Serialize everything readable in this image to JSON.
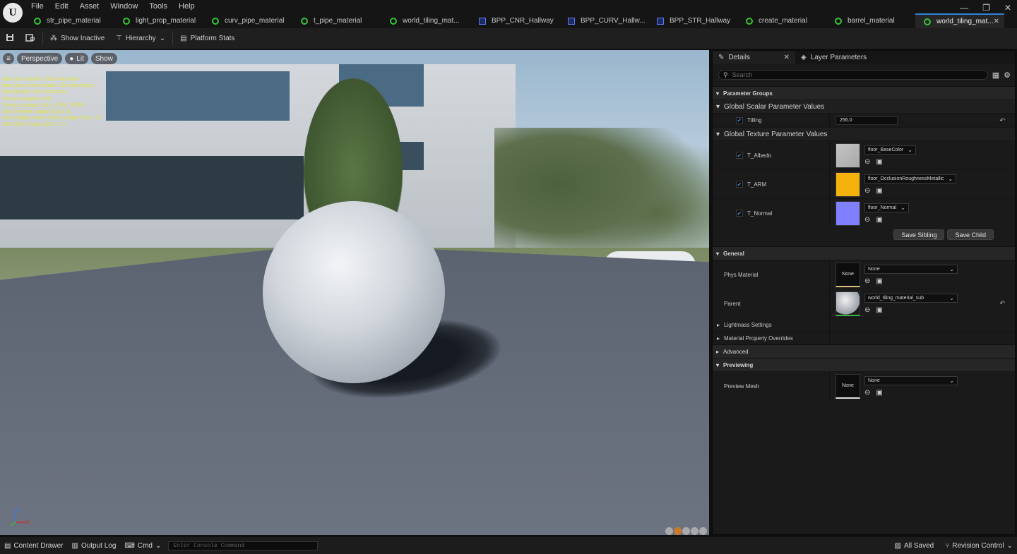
{
  "app": {
    "logo_text": "U"
  },
  "menu": [
    "File",
    "Edit",
    "Asset",
    "Window",
    "Tools",
    "Help"
  ],
  "window_controls": {
    "minimize": "—",
    "restore": "❐",
    "close": "✕"
  },
  "tabs": [
    {
      "label": "str_pipe_material",
      "icon": "material-icon"
    },
    {
      "label": "light_prop_material",
      "icon": "material-icon"
    },
    {
      "label": "curv_pipe_material",
      "icon": "material-icon"
    },
    {
      "label": "t_pipe_material",
      "icon": "material-icon"
    },
    {
      "label": "world_tiling_mat...",
      "icon": "material-icon"
    },
    {
      "label": "BPP_CNR_Hallway",
      "icon": "blueprint-icon"
    },
    {
      "label": "BPP_CURV_Hallw...",
      "icon": "blueprint-icon"
    },
    {
      "label": "BPP_STR_Hallway",
      "icon": "blueprint-icon"
    },
    {
      "label": "create_material",
      "icon": "material-icon"
    },
    {
      "label": "barrel_material",
      "icon": "material-icon"
    },
    {
      "label": "world_tiling_mat...",
      "icon": "material-icon",
      "active": true
    }
  ],
  "toolbar": {
    "show_inactive": "Show Inactive",
    "hierarchy": "Hierarchy",
    "platform_stats": "Platform Stats"
  },
  "viewport": {
    "perspective": "Perspective",
    "lit": "Lit",
    "show": "Show",
    "stats": [
      "Base pass shader: 295 instructions",
      "Base pass vertex shader: 131 instructions",
      "MaxSampler: 362 instructions",
      "Texture samplers: 5/16",
      "Texture Lookups (Est.): VS(0), PS(15)",
      "LWC Promote usages (Est.): 11",
      "LWC Multiply Vector Vector usages (Est.): 11",
      "LWC Other usages (Est.): 15"
    ],
    "axis_z": "Z",
    "axis_x": "X"
  },
  "details": {
    "tab_details": "Details",
    "tab_layer_params": "Layer Parameters",
    "search_placeholder": "Search",
    "parameter_groups": "Parameter Groups",
    "global_scalar": "Global Scalar Parameter Values",
    "tilling_label": "Tilling",
    "tilling_value": "256.0",
    "global_texture": "Global Texture Parameter Values",
    "textures": [
      {
        "label": "T_Albedo",
        "value": "floor_BaseColor",
        "color": "#b9b9b9"
      },
      {
        "label": "T_ARM",
        "value": "floor_OcclusionRoughnessMetallic",
        "color": "#f6b20c"
      },
      {
        "label": "T_Normal",
        "value": "floor_Normal",
        "color": "#8080ff"
      }
    ],
    "save_sibling": "Save Sibling",
    "save_child": "Save Child",
    "general": "General",
    "phys_material_label": "Phys Material",
    "phys_material_thumb": "None",
    "phys_material_value": "None",
    "parent_label": "Parent",
    "parent_value": "world_tiling_material_sub",
    "lightmass": "Lightmass Settings",
    "material_overrides": "Material Property Overrides",
    "advanced": "Advanced",
    "previewing": "Previewing",
    "preview_mesh_label": "Preview Mesh",
    "preview_mesh_thumb": "None",
    "preview_mesh_value": "None"
  },
  "bottom": {
    "content_drawer": "Content Drawer",
    "output_log": "Output Log",
    "cmd": "Cmd",
    "console_placeholder": "Enter Console Command",
    "all_saved": "All Saved",
    "revision_control": "Revision Control"
  }
}
